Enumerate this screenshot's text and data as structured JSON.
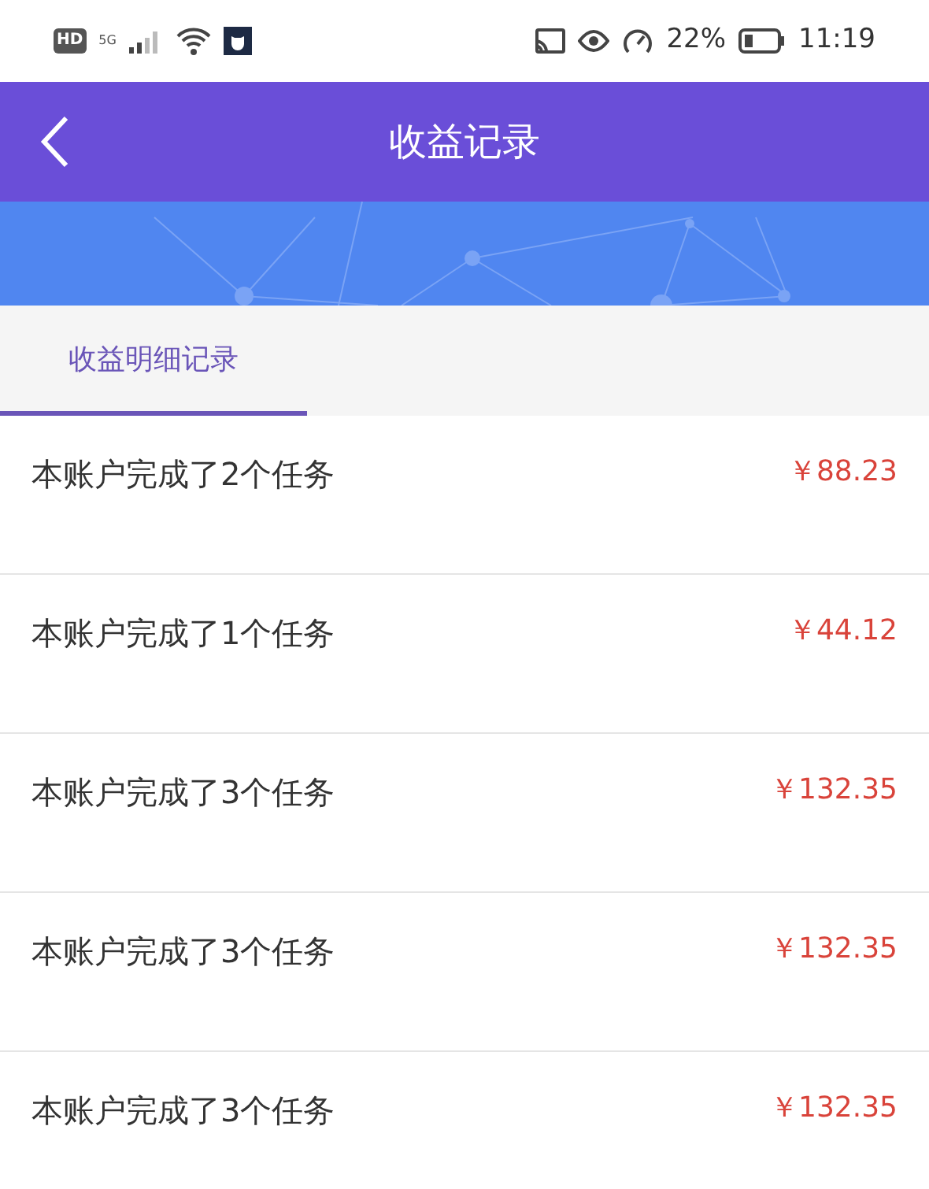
{
  "status_bar": {
    "left_badge": "HD",
    "network": "5G",
    "battery_percent": "22%",
    "time": "11:19"
  },
  "header": {
    "title": "收益记录"
  },
  "tabs": [
    {
      "label": "收益明细记录",
      "selected": true
    }
  ],
  "records": [
    {
      "description": "本账户完成了2个任务",
      "amount": "￥88.23"
    },
    {
      "description": "本账户完成了1个任务",
      "amount": "￥44.12"
    },
    {
      "description": "本账户完成了3个任务",
      "amount": "￥132.35"
    },
    {
      "description": "本账户完成了3个任务",
      "amount": "￥132.35"
    },
    {
      "description": "本账户完成了3个任务",
      "amount": "￥132.35"
    }
  ]
}
